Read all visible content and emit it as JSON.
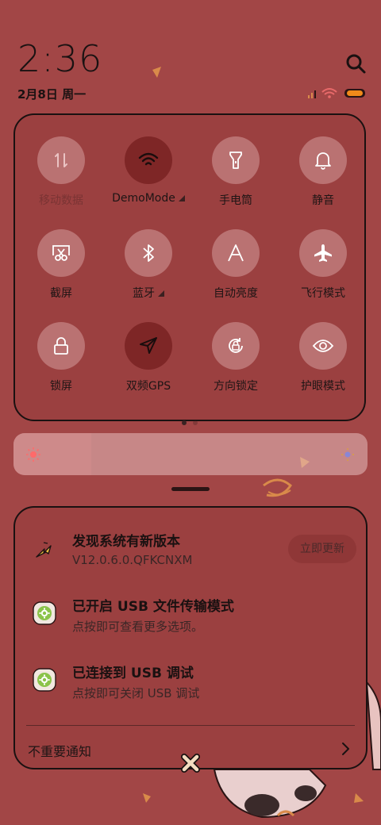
{
  "status": {
    "time": "2:36",
    "date": "2月8日 周一"
  },
  "quick_settings": {
    "tiles": [
      {
        "label": "移动数据",
        "icon": "mobile-data-icon",
        "state": "disabled"
      },
      {
        "label": "DemoMode",
        "icon": "wifi-icon",
        "state": "on"
      },
      {
        "label": "手电筒",
        "icon": "flashlight-icon",
        "state": "off"
      },
      {
        "label": "静音",
        "icon": "bell-icon",
        "state": "off"
      },
      {
        "label": "截屏",
        "icon": "screenshot-icon",
        "state": "off"
      },
      {
        "label": "蓝牙",
        "icon": "bluetooth-icon",
        "state": "off"
      },
      {
        "label": "自动亮度",
        "icon": "auto-brightness-icon",
        "state": "off"
      },
      {
        "label": "飞行模式",
        "icon": "airplane-icon",
        "state": "off"
      },
      {
        "label": "锁屏",
        "icon": "lock-icon",
        "state": "off"
      },
      {
        "label": "双频GPS",
        "icon": "navigation-icon",
        "state": "on"
      },
      {
        "label": "方向锁定",
        "icon": "rotation-lock-icon",
        "state": "off"
      },
      {
        "label": "护眼模式",
        "icon": "eye-icon",
        "state": "off"
      }
    ],
    "page_count": 2,
    "current_page": 1
  },
  "brightness": {
    "level": 0.22
  },
  "notifications": [
    {
      "title": "发现系统有新版本",
      "body": "V12.0.6.0.QFKCNXM",
      "action": "立即更新",
      "icon": "update-icon"
    },
    {
      "title": "已开启 USB 文件传输模式",
      "body": "点按即可查看更多选项。",
      "icon": "android-settings-icon"
    },
    {
      "title": "已连接到 USB 调试",
      "body": "点按即可关闭 USB 调试",
      "icon": "android-settings-icon"
    }
  ],
  "minor_notifications": {
    "label": "不重要通知"
  },
  "colors": {
    "background": "#a24646",
    "tile_active": "#7e2626",
    "accent_green": "#8bc34a"
  }
}
